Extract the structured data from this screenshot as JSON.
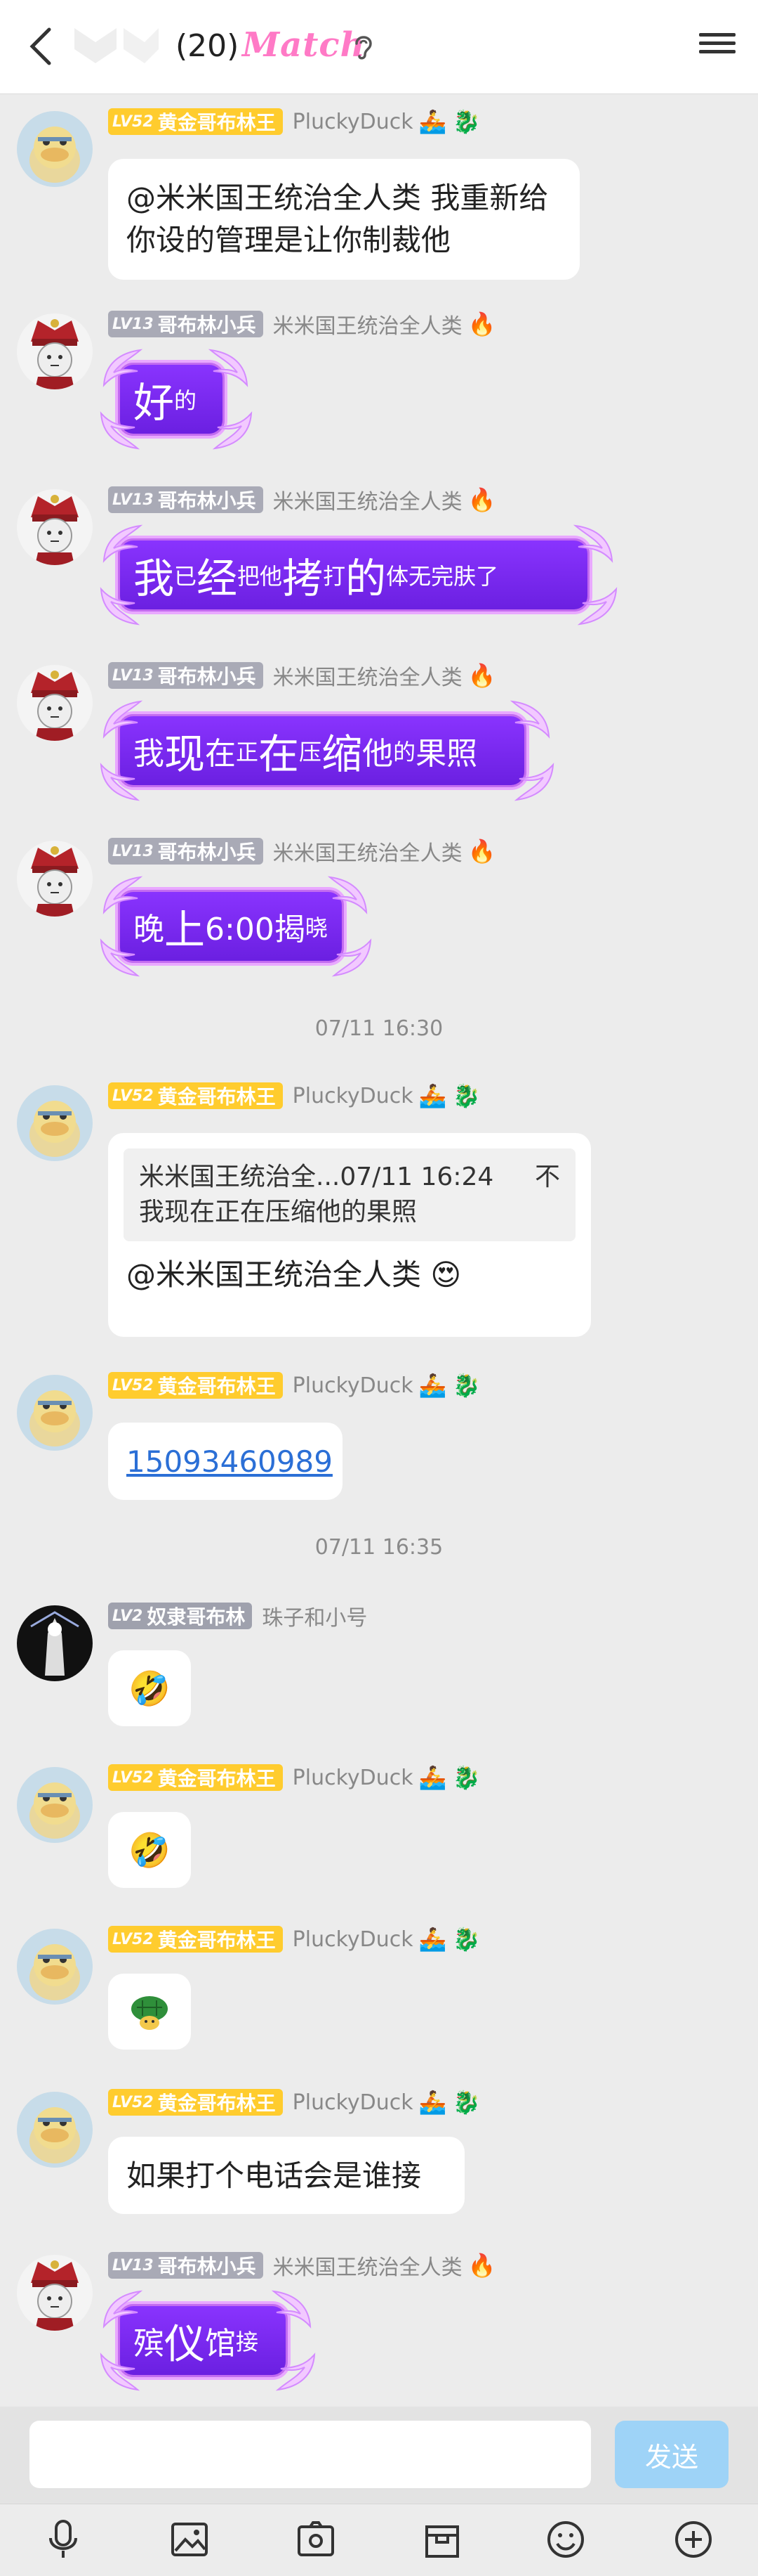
{
  "header": {
    "member_count": "(20)",
    "brand": "Match"
  },
  "messages": [
    {
      "level": "LV52",
      "title": "黄金哥布林王",
      "nickname": "PluckyDuck",
      "text": "@米米国王统治全人类 我重新给",
      "text2": "你设的管理是让你制裁他"
    },
    {
      "level": "LV13",
      "title": "哥布林小兵",
      "nickname": "米米国王统治全人类",
      "parts": [
        [
          "big",
          "好"
        ],
        [
          "sm",
          "的"
        ]
      ]
    },
    {
      "level": "LV13",
      "title": "哥布林小兵",
      "nickname": "米米国王统治全人类",
      "parts": [
        [
          "big",
          "我"
        ],
        [
          "sm",
          "已"
        ],
        [
          "big",
          "经"
        ],
        [
          "sm",
          "把他"
        ],
        [
          "big",
          "拷"
        ],
        [
          "sm",
          "打"
        ],
        [
          "big",
          "的"
        ],
        [
          "sm",
          "体无完肤了"
        ]
      ]
    },
    {
      "level": "LV13",
      "title": "哥布林小兵",
      "nickname": "米米国王统治全人类",
      "parts": [
        [
          "mid",
          "我"
        ],
        [
          "big",
          "现"
        ],
        [
          "mid",
          "在"
        ],
        [
          "sm",
          "正"
        ],
        [
          "big",
          "在"
        ],
        [
          "sm",
          "压"
        ],
        [
          "big",
          "缩"
        ],
        [
          "mid",
          "他"
        ],
        [
          "sm",
          "的"
        ],
        [
          "mid",
          "果照"
        ]
      ]
    },
    {
      "level": "LV13",
      "title": "哥布林小兵",
      "nickname": "米米国王统治全人类",
      "parts": [
        [
          "mid",
          "晚"
        ],
        [
          "big",
          "上"
        ],
        [
          "mid",
          "6:00揭"
        ],
        [
          "sm",
          "晓"
        ]
      ]
    }
  ],
  "time1": "07/11 16:30",
  "quote_msg": {
    "level": "LV52",
    "title": "黄金哥布林王",
    "nickname": "PluckyDuck",
    "quote_head": "米米国王统治全...07/11 16:24",
    "quote_pin": "不",
    "quote_text": "我现在正在压缩他的果照",
    "text": "@米米国王统治全人类 😍"
  },
  "phone_msg": {
    "level": "LV52",
    "title": "黄金哥布林王",
    "nickname": "PluckyDuck",
    "text": "15093460989"
  },
  "time2": "07/11 16:35",
  "slave_msg": {
    "level": "LV2",
    "title": "奴隶哥布林",
    "nickname": "珠子和小号",
    "text": "🤣"
  },
  "duck_emoji1": {
    "level": "LV52",
    "title": "黄金哥布林王",
    "nickname": "PluckyDuck",
    "text": "🤣"
  },
  "duck_emoji2": {
    "level": "LV52",
    "title": "黄金哥布林王",
    "nickname": "PluckyDuck",
    "text": "🐢"
  },
  "duck_text": {
    "level": "LV52",
    "title": "黄金哥布林王",
    "nickname": "PluckyDuck",
    "text": "如果打个电话会是谁接"
  },
  "last_msg": {
    "level": "LV13",
    "title": "哥布林小兵",
    "nickname": "米米国王统治全人类",
    "parts": [
      [
        "mid",
        "殡"
      ],
      [
        "big",
        "仪"
      ],
      [
        "mid",
        "馆"
      ],
      [
        "sm",
        "接"
      ]
    ]
  },
  "input": {
    "placeholder": "",
    "send": "发送"
  },
  "colors": {
    "gold": "#ffcc2e",
    "purple": "#7a28f0",
    "send": "#9ed3f7"
  }
}
